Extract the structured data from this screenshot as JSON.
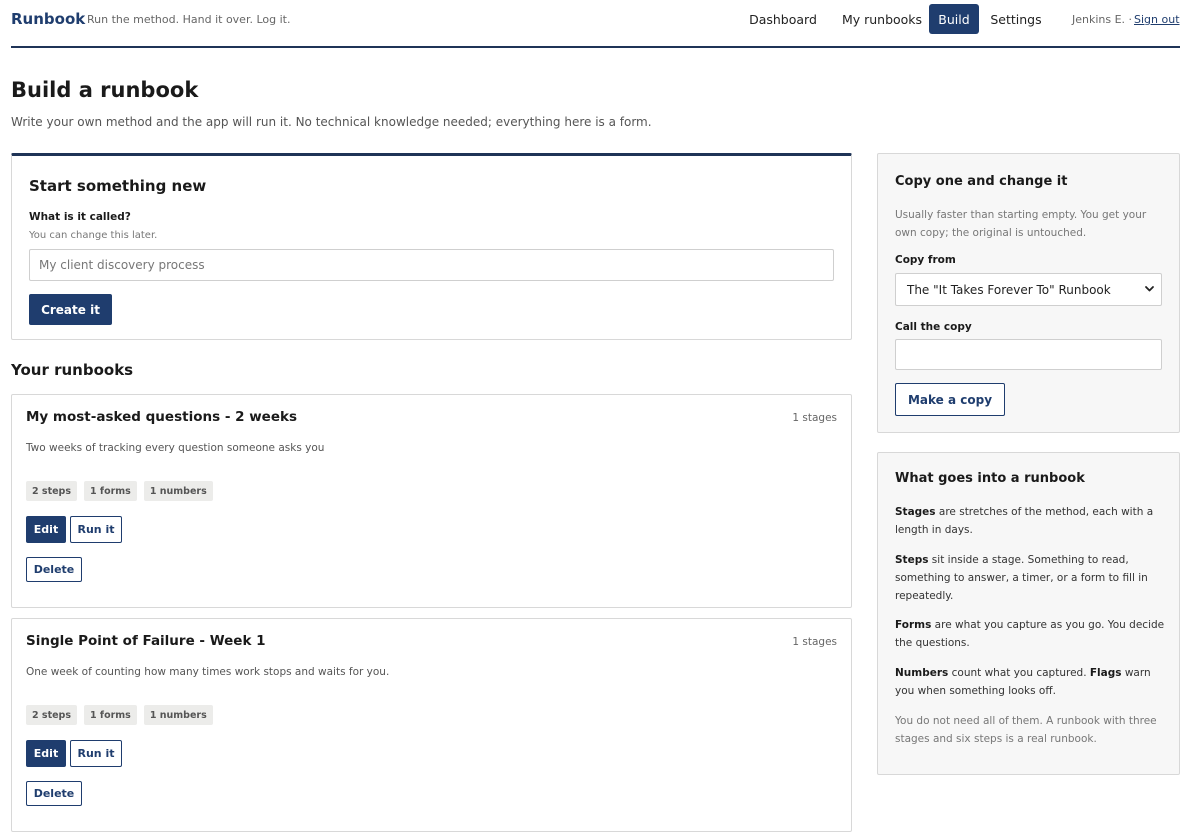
{
  "header": {
    "brand": "Runbook",
    "tagline": "Run the method. Hand it over. Log it.",
    "nav": [
      {
        "label": "Dashboard",
        "active": false
      },
      {
        "label": "My runbooks",
        "active": false
      },
      {
        "label": "Build",
        "active": true
      },
      {
        "label": "Settings",
        "active": false
      }
    ],
    "user": "Jenkins E. ·",
    "sign_out": "Sign out"
  },
  "page": {
    "title": "Build a runbook",
    "subtitle": "Write your own method and the app will run it. No technical knowledge needed; everything here is a form."
  },
  "start_new": {
    "heading": "Start something new",
    "name_label": "What is it called?",
    "name_hint": "You can change this later.",
    "name_placeholder": "My client discovery process",
    "name_value": "",
    "create_label": "Create it"
  },
  "runbooks": {
    "heading": "Your runbooks",
    "items": [
      {
        "name": "My most-asked questions - 2 weeks",
        "stages": "1 stages",
        "description": "Two weeks of tracking every question someone asks you",
        "tags": [
          "2 steps",
          "1 forms",
          "1 numbers"
        ],
        "edit_label": "Edit",
        "run_label": "Run it",
        "delete_label": "Delete"
      },
      {
        "name": "Single Point of Failure - Week 1",
        "stages": "1 stages",
        "description": "One week of counting how many times work stops and waits for you.",
        "tags": [
          "2 steps",
          "1 forms",
          "1 numbers"
        ],
        "edit_label": "Edit",
        "run_label": "Run it",
        "delete_label": "Delete"
      }
    ]
  },
  "copy_panel": {
    "heading": "Copy one and change it",
    "description": "Usually faster than starting empty. You get your own copy; the original is untouched.",
    "copy_from_label": "Copy from",
    "copy_from_selected": "The \"It Takes Forever To\" Runbook",
    "call_label": "Call the copy",
    "call_value": "",
    "make_copy_label": "Make a copy"
  },
  "help_panel": {
    "heading": "What goes into a runbook",
    "items": [
      {
        "term": "Stages",
        "text": " are stretches of the method, each with a length in days."
      },
      {
        "term": "Steps",
        "text": " sit inside a stage. Something to read, something to answer, a timer, or a form to fill in repeatedly."
      },
      {
        "term": "Forms",
        "text": " are what you capture as you go. You decide the questions."
      },
      {
        "term": "Numbers",
        "text": " count what you captured. ",
        "term2": "Flags",
        "text2": " warn you when something looks off."
      }
    ],
    "note": "You do not need all of them. A runbook with three stages and six steps is a real runbook."
  },
  "icons": {
    "select_chevron": "chevron-down-icon"
  },
  "colors": {
    "primary": "#1f3d6e",
    "header_rule": "#1f3457",
    "sidebar_bg": "#f7f7f7",
    "tag_bg": "#ececea"
  }
}
